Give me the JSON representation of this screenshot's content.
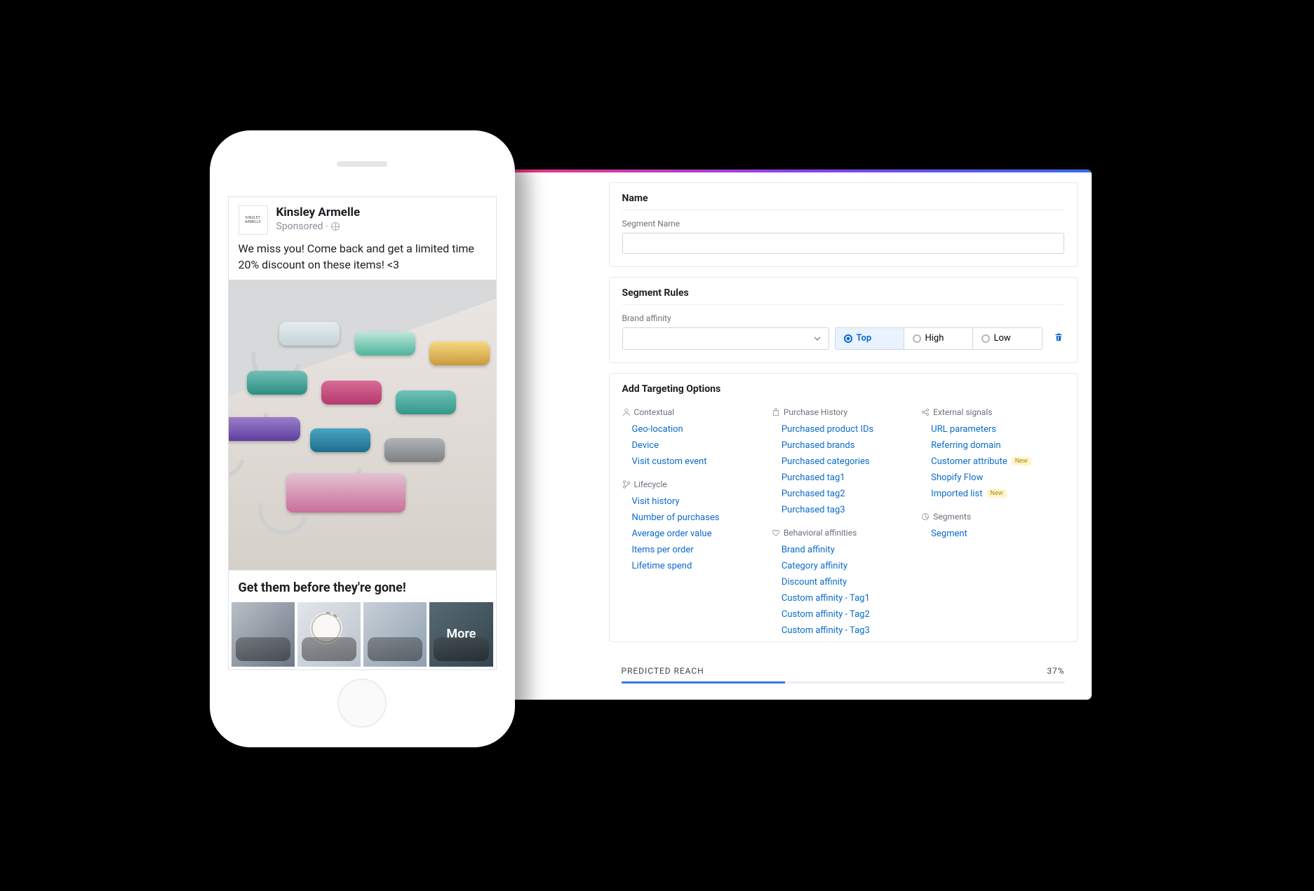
{
  "phone_ad": {
    "brand_logo_text": "KINSLEY ARMELLE",
    "brand_name": "Kinsley Armelle",
    "sponsored_label": "Sponsored ·",
    "body_text": "We miss you! Come back and get a limited time 20% discount on these items! <3",
    "cta_headline": "Get them before they're gone!",
    "more_label": "More"
  },
  "panel": {
    "name_section": {
      "title": "Name",
      "field_label": "Segment Name",
      "value": ""
    },
    "rules_section": {
      "title": "Segment Rules",
      "rule_label": "Brand affinity",
      "segments": {
        "top": "Top",
        "high": "High",
        "low": "Low"
      }
    },
    "options_section": {
      "title": "Add Targeting Options",
      "groups": {
        "contextual": {
          "title": "Contextual",
          "items": [
            "Geo-location",
            "Device",
            "Visit custom event"
          ]
        },
        "lifecycle": {
          "title": "Lifecycle",
          "items": [
            "Visit history",
            "Number of purchases",
            "Average order value",
            "Items per order",
            "Lifetime spend"
          ]
        },
        "purchase": {
          "title": "Purchase History",
          "items": [
            "Purchased product IDs",
            "Purchased brands",
            "Purchased categories",
            "Purchased tag1",
            "Purchased tag2",
            "Purchased tag3"
          ]
        },
        "behavioral": {
          "title": "Behavioral affinities",
          "items": [
            "Brand affinity",
            "Category affinity",
            "Discount affinity",
            "Custom affinity - Tag1",
            "Custom affinity - Tag2",
            "Custom affinity - Tag3"
          ]
        },
        "external": {
          "title": "External signals",
          "items": [
            "URL parameters",
            "Referring domain",
            "Customer attribute",
            "Shopify Flow",
            "Imported list"
          ],
          "badges": {
            "2": "New",
            "4": "New"
          }
        },
        "segments": {
          "title": "Segments",
          "items": [
            "Segment"
          ]
        }
      }
    },
    "predicted": {
      "label": "PREDICTED REACH",
      "value": "37%",
      "percent": 37
    }
  }
}
